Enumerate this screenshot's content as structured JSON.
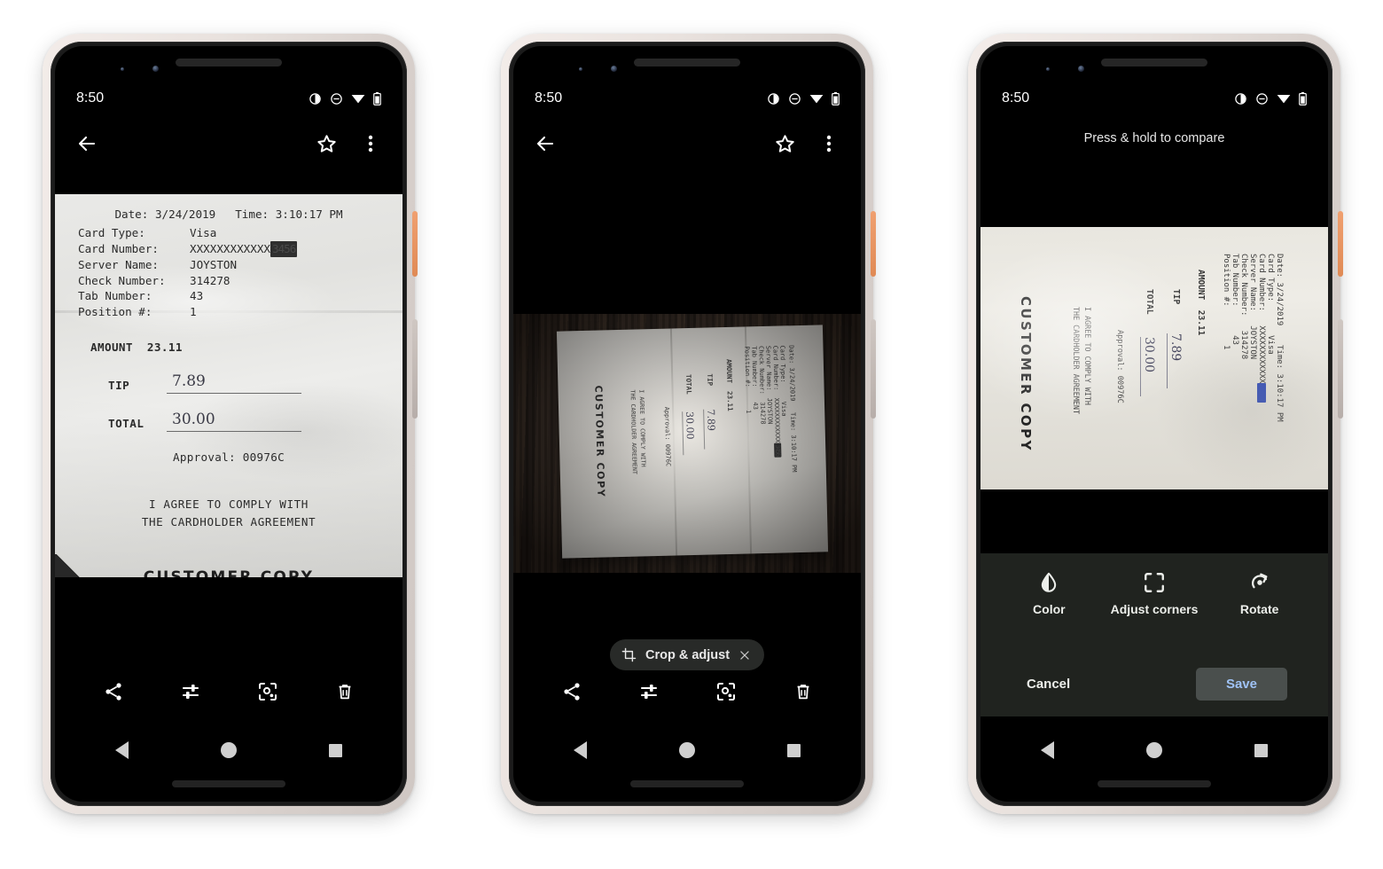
{
  "background_color": "#ffffff",
  "status_bar": {
    "time": "8:50",
    "icons": [
      "brightness-icon",
      "do-not-disturb-icon",
      "wifi-icon",
      "battery-icon"
    ]
  },
  "receipt": {
    "date_label": "Date:",
    "date_value": "3/24/2019",
    "time_label": "Time:",
    "time_value": "3:10:17 PM",
    "fields": [
      {
        "key": "Card Type:",
        "value": "Visa"
      },
      {
        "key": "Card Number:",
        "value": "XXXXXXXXXXXX",
        "redacted": "3456"
      },
      {
        "key": "Server Name:",
        "value": "JOYSTON"
      },
      {
        "key": "Check Number:",
        "value": "314278"
      },
      {
        "key": "Tab Number:",
        "value": "43"
      },
      {
        "key": "Position #:",
        "value": "1"
      }
    ],
    "amount_label": "AMOUNT",
    "amount_value": "23.11",
    "tip_label": "TIP",
    "tip_value": "7.89",
    "total_label": "TOTAL",
    "total_value": "30.00",
    "approval": "Approval: 00976C",
    "agreement_line1": "I AGREE TO COMPLY WITH",
    "agreement_line2": "THE CARDHOLDER AGREEMENT",
    "customer_copy": "CUSTOMER  COPY"
  },
  "phone1": {
    "appbar": {
      "back": "back-arrow-icon",
      "star": "star-icon",
      "overflow": "more-options-icon"
    },
    "toolbar": [
      {
        "name": "share-icon",
        "label": "Share"
      },
      {
        "name": "tune-icon",
        "label": "Adjust"
      },
      {
        "name": "lens-icon",
        "label": "Lens"
      },
      {
        "name": "delete-icon",
        "label": "Delete"
      }
    ]
  },
  "phone2": {
    "chip": {
      "icon": "crop-icon",
      "label": "Crop & adjust",
      "close": "close-icon"
    }
  },
  "phone3": {
    "header_hint": "Press & hold to compare",
    "tools": [
      {
        "icon": "color-drop-icon",
        "label": "Color"
      },
      {
        "icon": "adjust-corners-icon",
        "label": "Adjust\ncorners"
      },
      {
        "icon": "rotate-icon",
        "label": "Rotate"
      }
    ],
    "tool_labels": [
      "Color",
      "Adjust corners",
      "Rotate"
    ],
    "cancel_label": "Cancel",
    "save_label": "Save",
    "save_text_color": "#9fc2f5",
    "panel_color": "#20231f"
  },
  "navigation": {
    "back": "nav-back-icon",
    "home": "nav-home-icon",
    "recents": "nav-recents-icon"
  }
}
